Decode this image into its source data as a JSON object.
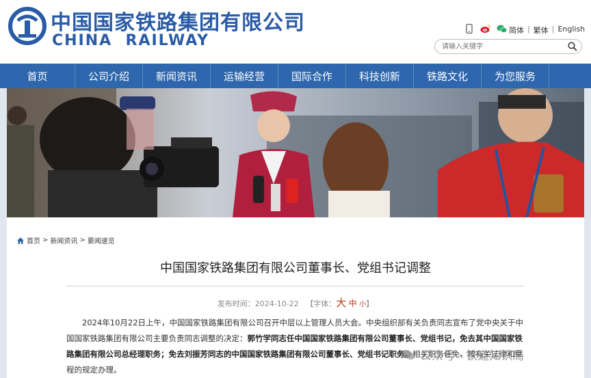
{
  "header": {
    "logo_cn": "中国国家铁路集团有限公司",
    "logo_en": "CHINA  RAILWAY",
    "icons": [
      "phone-icon",
      "weibo-icon",
      "wechat-icon"
    ],
    "lang": {
      "simplified": "简体",
      "traditional": "繁体",
      "english": "English",
      "separator": "|"
    },
    "search": {
      "placeholder": "请输入关键字"
    }
  },
  "nav": {
    "items": [
      "首页",
      "公司介绍",
      "新闻资讯",
      "运输经营",
      "国际合作",
      "科技创新",
      "铁路文化",
      "为您服务"
    ]
  },
  "breadcrumb": {
    "items": [
      "首页",
      "新闻资讯",
      "要闻速览"
    ],
    "separator": ">"
  },
  "article": {
    "title": "中国国家铁路集团有限公司董事长、党组书记调整",
    "meta": {
      "date_label": "发布时间：",
      "date": "2024-10-22",
      "font_open": "【字体：",
      "font_big": "大",
      "font_mid": "中",
      "font_small": "小",
      "font_close": "】"
    },
    "paragraph": {
      "part1": "2024年10月22日上午，中国国家铁路集团有限公司召开中层以上管理人员大会。中央组织部有关负责同志宣布了党中央关于中国国家铁路集团有限公司主要负责同志调整的决定：",
      "part2": "郭竹学同志任中国国家铁路集团有限公司董事长、党组书记，免去其中国国家铁路集团有限公司总经理职务；免去刘振芳同志的中国国家铁路集团有限公司董事长、党组书记职务。",
      "part3": "相关职务任免，按有关法律和章程的规定办理。"
    }
  },
  "watermark": {
    "text": "公众号 · 铁道知识局"
  },
  "colors": {
    "brand_blue": "#2e67ad",
    "logo_blue": "#2a5ba6",
    "accent_red": "#b53a1e"
  }
}
